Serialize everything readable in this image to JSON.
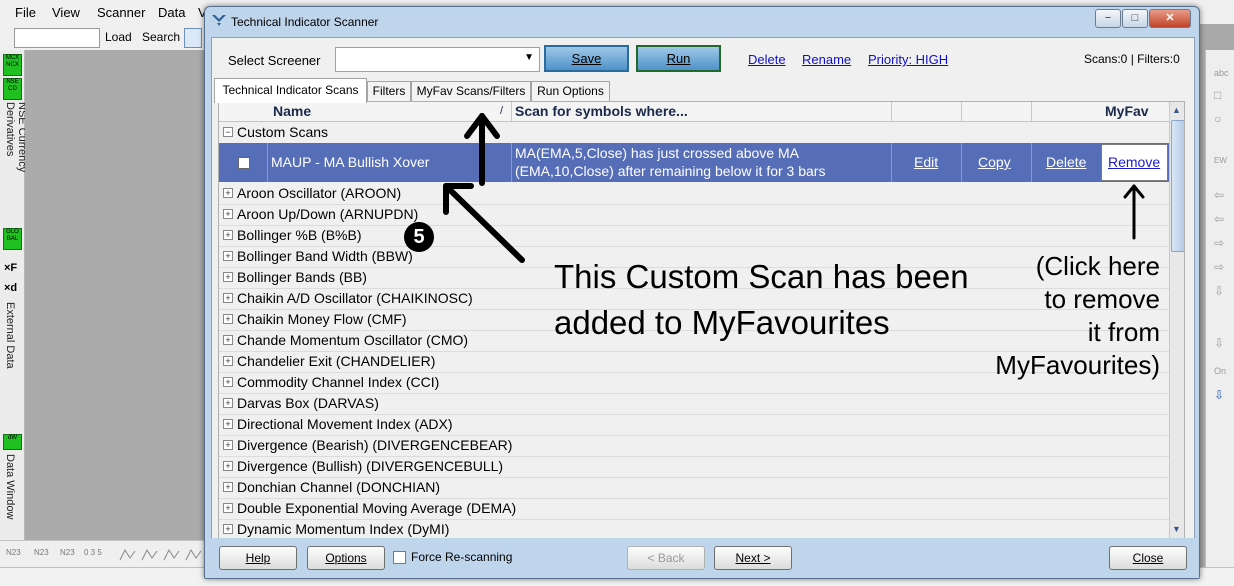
{
  "app": {
    "menu": [
      "File",
      "View",
      "Scanner",
      "Data",
      "V"
    ],
    "toolbar": {
      "load": "Load",
      "search": "Search"
    },
    "left_tabs": {
      "currency": "NSE Currency Derivatives",
      "external": "External Data",
      "datawin": "Data Window"
    },
    "left_badges": {
      "mcx": "MCX NCX",
      "nse": "NSE CD",
      "global": "GLO BAL",
      "dw": "dW"
    },
    "left_glyphs": {
      "xf": "×F",
      "xd": "×d"
    },
    "bottom_toolbar": [
      "N23",
      "N23",
      "N23",
      "0 3 5"
    ],
    "right_icons": [
      "abc",
      "□",
      "○",
      "EW",
      "⇦",
      "⇦",
      "⇨",
      "⇨",
      "⇩",
      "⇩",
      "On",
      "⇩"
    ]
  },
  "dialog": {
    "title": "Technical Indicator Scanner",
    "window_buttons": [
      "−",
      "□",
      "✕"
    ],
    "select_label": "Select Screener",
    "selected_value": "",
    "save": "Save",
    "run": "Run",
    "delete": "Delete",
    "rename": "Rename",
    "priority": "Priority: HIGH",
    "counts": "Scans:0 | Filters:0",
    "tabs": [
      "Technical Indicator Scans",
      "Filters",
      "MyFav Scans/Filters",
      "Run Options"
    ],
    "columns": {
      "name": "Name",
      "sort": "/",
      "scan": "Scan for symbols where...",
      "myfav": "MyFav"
    },
    "group": "Custom Scans",
    "selected": {
      "name": "MAUP - MA Bullish Xover",
      "desc1": "MA(EMA,5,Close) has just crossed above MA",
      "desc2": "(EMA,10,Close) after remaining below it for 3 bars",
      "edit": "Edit",
      "copy": "Copy",
      "delete": "Delete",
      "remove": "Remove"
    },
    "indicators": [
      "Aroon Oscillator (AROON)",
      "Aroon Up/Down (ARNUPDN)",
      "Bollinger %B (B%B)",
      "Bollinger Band Width (BBW)",
      "Bollinger Bands (BB)",
      "Chaikin A/D Oscillator (CHAIKINOSC)",
      "Chaikin Money Flow (CMF)",
      "Chande Momentum Oscillator (CMO)",
      "Chandelier Exit (CHANDELIER)",
      "Commodity Channel Index (CCI)",
      "Darvas Box (DARVAS)",
      "Directional Movement Index (ADX)",
      "Divergence (Bearish) (DIVERGENCEBEAR)",
      "Divergence (Bullish) (DIVERGENCEBULL)",
      "Donchian Channel (DONCHIAN)",
      "Double Exponential Moving Average (DEMA)",
      "Dynamic Momentum Index (DyMI)"
    ],
    "footer": {
      "help": "Help",
      "options": "Options",
      "force": "Force Re-scanning",
      "back": "< Back",
      "next": "Next >",
      "close": "Close"
    }
  },
  "annotations": {
    "step": "5",
    "main_line1": "This Custom Scan has been",
    "main_line2": "added to MyFavourites",
    "side": [
      "(Click here",
      "to remove",
      "it from",
      "MyFavourites)"
    ]
  }
}
